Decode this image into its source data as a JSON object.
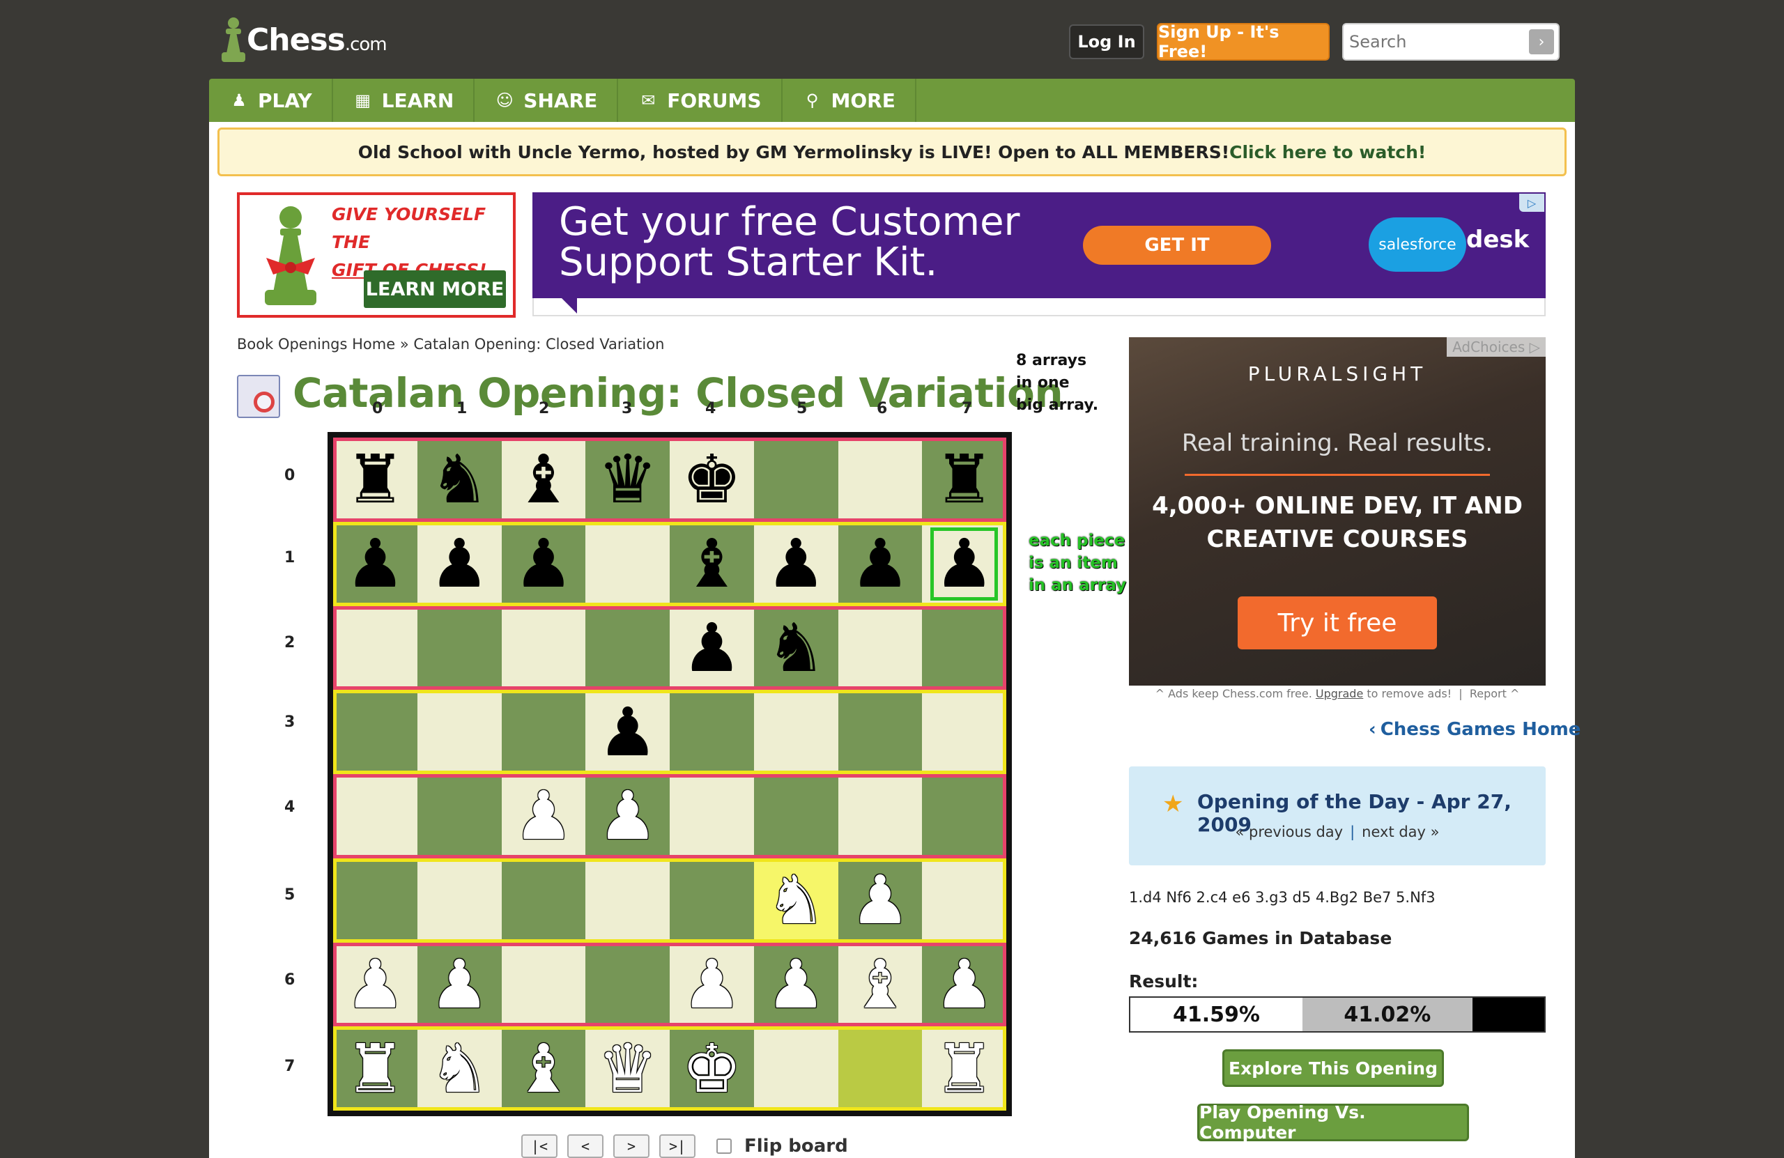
{
  "brand": {
    "logo_main": "Chess",
    "logo_suffix": ".com"
  },
  "header": {
    "login": "Log In",
    "signup": "Sign Up - It's Free!",
    "search_placeholder": "Search"
  },
  "nav": [
    {
      "label": "PLAY",
      "icon": "play-icon"
    },
    {
      "label": "LEARN",
      "icon": "learn-icon"
    },
    {
      "label": "SHARE",
      "icon": "share-icon"
    },
    {
      "label": "FORUMS",
      "icon": "forums-icon"
    },
    {
      "label": "MORE",
      "icon": "search-icon"
    }
  ],
  "banner": {
    "text": "Old School with Uncle Yermo, hosted by GM Yermolinsky is LIVE! Open to ALL MEMBERS!",
    "link": "Click here to watch!"
  },
  "ad_left": {
    "line1": "GIVE YOURSELF THE",
    "line2_u": "GIFT",
    "line2_rest": " OF CHESS!",
    "button": "LEARN MORE"
  },
  "ad_top": {
    "headline1": "Get your free Customer",
    "headline2": "Support Starter Kit.",
    "button": "GET IT",
    "brand1": "salesforce",
    "brand2": "desk"
  },
  "breadcrumb": {
    "home": "Book Openings Home",
    "sep": "»",
    "current": "Catalan Opening: Closed Variation"
  },
  "title": "Catalan Opening: Closed Variation",
  "annotations": {
    "col_labels": [
      "0",
      "1",
      "2",
      "3",
      "4",
      "5",
      "6",
      "7"
    ],
    "row_labels": [
      "0",
      "1",
      "2",
      "3",
      "4",
      "5",
      "6",
      "7"
    ],
    "note_arrays": "8 arrays in one big array.",
    "note_item": "each piece is an item in an array",
    "row_highlight_colors": [
      "#e6436a",
      "#f0e51b"
    ],
    "selected_cell": {
      "row": 1,
      "col": 7,
      "color": "#27c627"
    }
  },
  "board": {
    "light": "#eeeed2",
    "dark": "#769656",
    "rows": [
      [
        "br",
        "bn",
        "bb",
        "bq",
        "bk",
        "",
        "",
        "br"
      ],
      [
        "bp",
        "bp",
        "bp",
        "",
        "bb",
        "bp",
        "bp",
        "bp"
      ],
      [
        "",
        "",
        "",
        "",
        "bp",
        "bn",
        "",
        ""
      ],
      [
        "",
        "",
        "",
        "bp",
        "",
        "",
        "",
        ""
      ],
      [
        "",
        "",
        "wp",
        "wp",
        "",
        "",
        "",
        ""
      ],
      [
        "",
        "",
        "",
        "",
        "",
        "wn",
        "wp",
        ""
      ],
      [
        "wp",
        "wp",
        "",
        "",
        "wp",
        "wp",
        "wb",
        "wp"
      ],
      [
        "wr",
        "wn",
        "wb",
        "wq",
        "wk",
        "",
        "",
        "wr"
      ]
    ],
    "highlight_squares": [
      [
        5,
        5
      ],
      [
        7,
        6
      ]
    ]
  },
  "controls": {
    "first": "|<",
    "prev": "<",
    "next": ">",
    "last": ">|",
    "flip": "Flip board"
  },
  "ad_right": {
    "adchoices": "AdChoices",
    "brand": "PLURALSIGHT",
    "tagline": "Real training. Real results.",
    "courses1": "4,000+ ONLINE DEV, IT AND",
    "courses2": "CREATIVE COURSES",
    "button": "Try it free",
    "note_pre": "^ Ads keep Chess.com free.",
    "note_link": "Upgrade",
    "note_post": "to remove ads!",
    "report": "Report ^"
  },
  "sidebar": {
    "games_home": "Chess Games Home",
    "otd_title": "Opening of the Day - Apr 27, 2009",
    "prev_day": "« previous day",
    "next_day": "next day »",
    "moves": "1.d4 Nf6 2.c4 e6 3.g3 d5 4.Bg2 Be7 5.Nf3",
    "games_count": "24,616 Games in Database",
    "result_label": "Result:",
    "result_white": "41.59%",
    "result_draw": "41.02%",
    "result_white_frac": 0.4159,
    "result_draw_frac": 0.4102,
    "explore": "Explore This Opening",
    "play_computer": "Play Opening Vs. Computer"
  }
}
